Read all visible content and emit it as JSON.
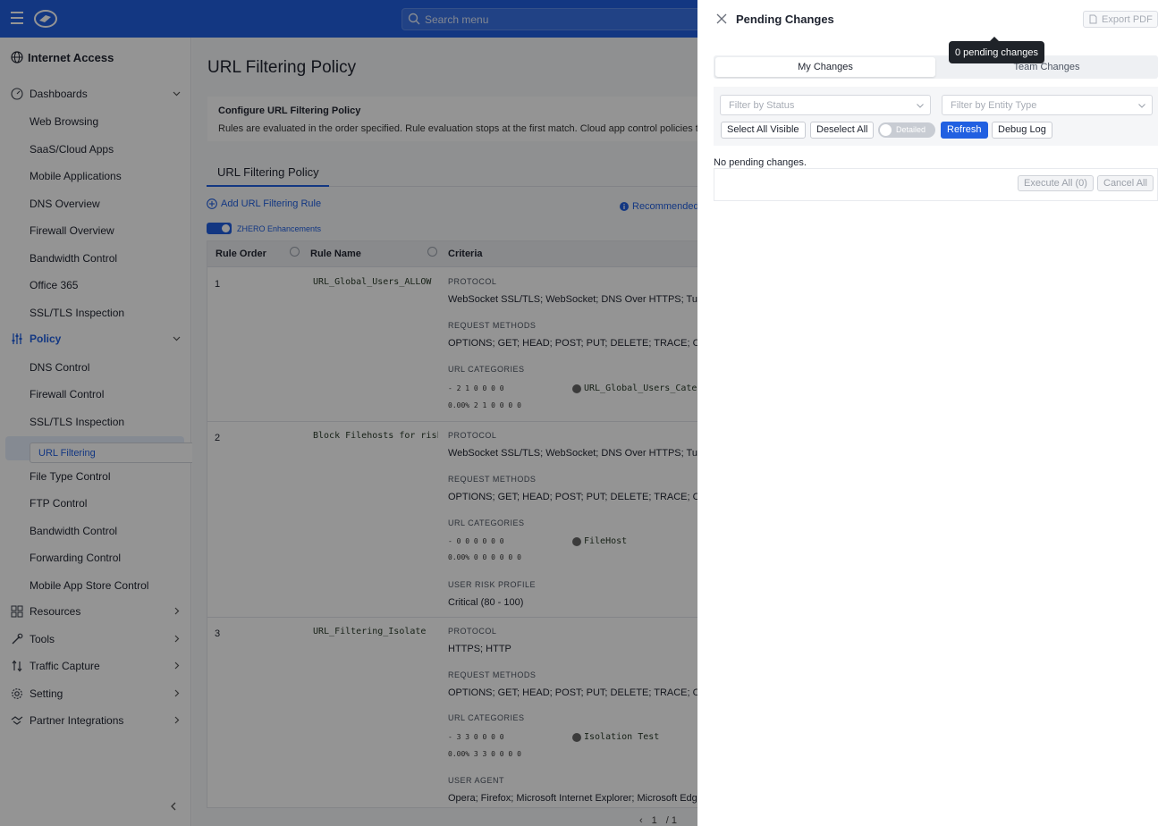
{
  "header": {
    "search_placeholder": "Search menu"
  },
  "sidebar": {
    "title": "Internet Access",
    "sections": [
      {
        "label": "Dashboards"
      },
      {
        "label": "Policy"
      },
      {
        "label": "Resources"
      },
      {
        "label": "Tools"
      },
      {
        "label": "Traffic Capture"
      },
      {
        "label": "Setting"
      },
      {
        "label": "Partner Integrations"
      }
    ],
    "dashboard_items": [
      "Web Browsing",
      "SaaS/Cloud Apps",
      "Mobile Applications",
      "DNS Overview",
      "Firewall Overview",
      "Bandwidth Control",
      "Office 365",
      "SSL/TLS Inspection"
    ],
    "policy_items": [
      "DNS Control",
      "Firewall Control",
      "SSL/TLS Inspection",
      "URL Filtering",
      "File Type Control",
      "FTP Control",
      "Bandwidth Control",
      "Forwarding Control",
      "Mobile App Store Control"
    ],
    "selected": "URL Filtering"
  },
  "main": {
    "page_title": "URL Filtering Policy",
    "desc_heading": "Configure URL Filtering Policy",
    "desc_body": "Rules are evaluated in the order specified. Rule evaluation stops at the first match. Cloud app control policies take p",
    "tab": "URL Filtering Policy",
    "add_rule": "Add URL Filtering Rule",
    "recommended": "Recommended",
    "zhero": "ZHERO Enhancements",
    "columns": {
      "order": "Rule Order",
      "name": "Rule Name",
      "criteria": "Criteria"
    },
    "rows": [
      {
        "order": "1",
        "name": "URL_Global_Users_ALLOW",
        "protocol_label": "PROTOCOL",
        "protocol": "WebSocket SSL/TLS; WebSocket; DNS Over HTTPS; Tun...",
        "methods_label": "REQUEST METHODS",
        "methods": "OPTIONS; GET; HEAD; POST; PUT; DELETE; TRACE; CON...",
        "categories_label": "URL CATEGORIES",
        "digits_top": "-  2  1  0  0  0  0",
        "digits_bottom": "0.00%  2  1  0  0  0  0",
        "category": "URL_Global_Users_Category"
      },
      {
        "order": "2",
        "name": "Block Filehosts for risky u",
        "protocol_label": "PROTOCOL",
        "protocol": "WebSocket SSL/TLS; WebSocket; DNS Over HTTPS; Tun...",
        "methods_label": "REQUEST METHODS",
        "methods": "OPTIONS; GET; HEAD; POST; PUT; DELETE; TRACE; CON...",
        "categories_label": "URL CATEGORIES",
        "digits_top": "-  0  0  0  0  0  0",
        "digits_bottom": "0.00%  0  0  0  0  0  0",
        "category": "FileHost",
        "risk_label": "USER RISK PROFILE",
        "risk": "Critical (80 - 100)"
      },
      {
        "order": "3",
        "name": "URL_Filtering_Isolate",
        "protocol_label": "PROTOCOL",
        "protocol": "HTTPS; HTTP",
        "methods_label": "REQUEST METHODS",
        "methods": "OPTIONS; GET; HEAD; POST; PUT; DELETE; TRACE; CON...",
        "categories_label": "URL CATEGORIES",
        "digits_top": "-  3  3  0  0  0  0",
        "digits_bottom": "0.00%  3  3  0  0  0  0",
        "category": "Isolation Test",
        "agent_label": "USER AGENT",
        "agent": "Opera; Firefox; Microsoft Internet Explorer; Microsoft Edg..."
      }
    ],
    "pager_current": "1",
    "pager_total": "/ 1"
  },
  "drawer": {
    "title": "Pending Changes",
    "export": "Export PDF",
    "tooltip": "0 pending changes",
    "tab_mine": "My Changes",
    "tab_team": "Team Changes",
    "filter_status": "Filter by Status",
    "filter_entity": "Filter by Entity Type",
    "select_all": "Select All Visible",
    "deselect_all": "Deselect All",
    "detailed": "Detailed",
    "refresh": "Refresh",
    "debug": "Debug Log",
    "empty": "No pending changes.",
    "execute": "Execute All (0)",
    "cancel": "Cancel All"
  },
  "colors": {
    "brand": "#2160e1",
    "overlay": "rgba(0,0,0,0.42)"
  }
}
